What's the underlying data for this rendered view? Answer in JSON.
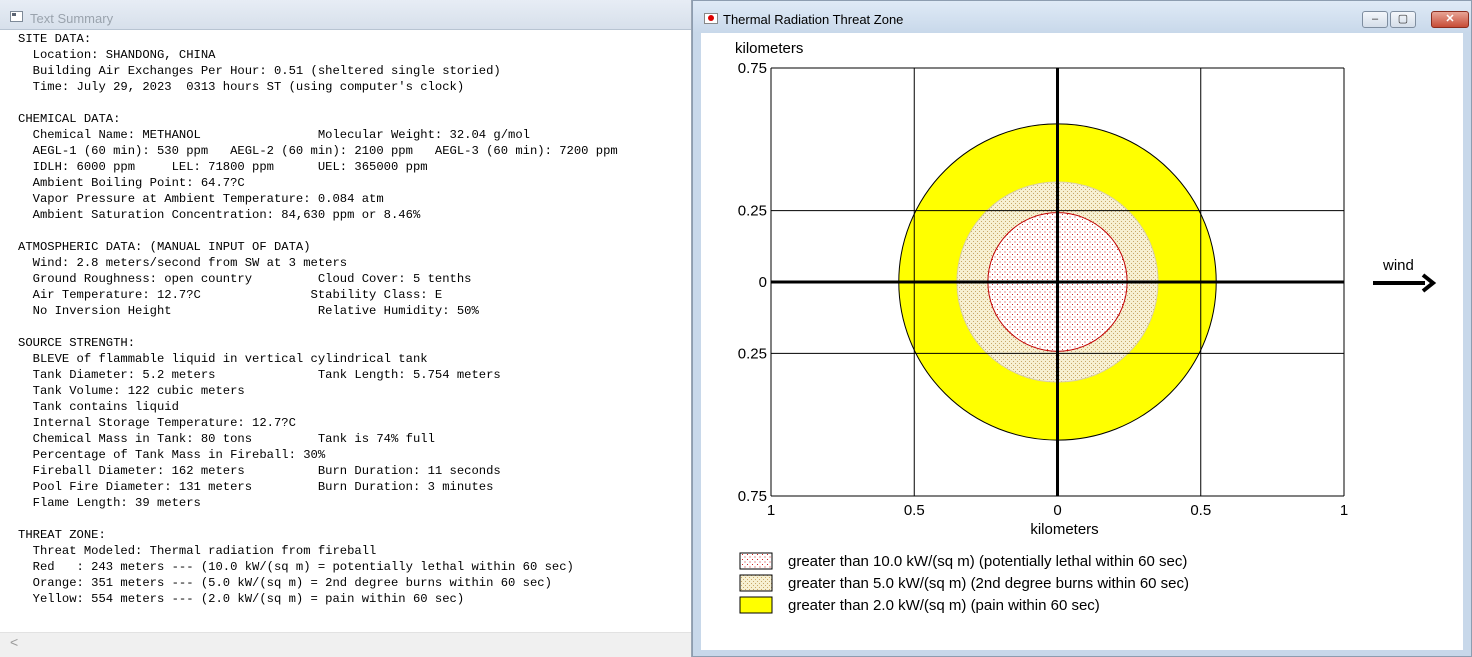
{
  "summary_window": {
    "title": "Text Summary",
    "lines": [
      "SITE DATA:",
      "  Location: SHANDONG, CHINA",
      "  Building Air Exchanges Per Hour: 0.51 (sheltered single storied)",
      "  Time: July 29, 2023  0313 hours ST (using computer's clock)",
      "",
      "CHEMICAL DATA:",
      "  Chemical Name: METHANOL                Molecular Weight: 32.04 g/mol",
      "  AEGL-1 (60 min): 530 ppm   AEGL-2 (60 min): 2100 ppm   AEGL-3 (60 min): 7200 ppm",
      "  IDLH: 6000 ppm     LEL: 71800 ppm      UEL: 365000 ppm",
      "  Ambient Boiling Point: 64.7?C",
      "  Vapor Pressure at Ambient Temperature: 0.084 atm",
      "  Ambient Saturation Concentration: 84,630 ppm or 8.46%",
      "",
      "ATMOSPHERIC DATA: (MANUAL INPUT OF DATA)",
      "  Wind: 2.8 meters/second from SW at 3 meters",
      "  Ground Roughness: open country         Cloud Cover: 5 tenths",
      "  Air Temperature: 12.7?C               Stability Class: E",
      "  No Inversion Height                    Relative Humidity: 50%",
      "",
      "SOURCE STRENGTH:",
      "  BLEVE of flammable liquid in vertical cylindrical tank",
      "  Tank Diameter: 5.2 meters              Tank Length: 5.754 meters",
      "  Tank Volume: 122 cubic meters",
      "  Tank contains liquid",
      "  Internal Storage Temperature: 12.7?C",
      "  Chemical Mass in Tank: 80 tons         Tank is 74% full",
      "  Percentage of Tank Mass in Fireball: 30%",
      "  Fireball Diameter: 162 meters          Burn Duration: 11 seconds",
      "  Pool Fire Diameter: 131 meters         Burn Duration: 3 minutes",
      "  Flame Length: 39 meters",
      "",
      "THREAT ZONE:",
      "  Threat Modeled: Thermal radiation from fireball",
      "  Red   : 243 meters --- (10.0 kW/(sq m) = potentially lethal within 60 sec)",
      "  Orange: 351 meters --- (5.0 kW/(sq m) = 2nd degree burns within 60 sec)",
      "  Yellow: 554 meters --- (2.0 kW/(sq m) = pain within 60 sec)"
    ],
    "scroll_left_glyph": "<"
  },
  "threat_window": {
    "title": "Thermal Radiation Threat Zone",
    "buttons": {
      "minimize": "–",
      "maximize": "▢",
      "close": "✕"
    },
    "wind_label": "wind"
  },
  "chart_data": {
    "type": "threat-zone-circles",
    "y_axis_unit": "kilometers",
    "x_axis_unit": "kilometers",
    "y_tick_labels": [
      "0.75",
      "0.25",
      "0",
      "0.25",
      "0.75"
    ],
    "x_tick_labels": [
      "1",
      "0.5",
      "0",
      "0.5",
      "1"
    ],
    "xlim": [
      -1,
      1
    ],
    "ylim": [
      -0.75,
      0.75
    ],
    "grid_x": [
      -1,
      -0.5,
      0,
      0.5,
      1
    ],
    "grid_y": [
      -0.75,
      -0.25,
      0,
      0.25,
      0.75
    ],
    "wind_direction": "right",
    "zones": [
      {
        "radius_km": 0.554,
        "color": "#ffff00",
        "pattern": "solid",
        "legend": "greater than 2.0 kW/(sq m) (pain within 60 sec)"
      },
      {
        "radius_km": 0.351,
        "color": "#f2ecc8",
        "pattern": "dots-orange",
        "legend": "greater than 5.0 kW/(sq m) (2nd degree burns within 60 sec)"
      },
      {
        "radius_km": 0.243,
        "color": "#ffffff",
        "pattern": "dots-red",
        "legend": "greater than 10.0 kW/(sq m) (potentially lethal within 60 sec)"
      }
    ],
    "legend_order": [
      2,
      1,
      0
    ]
  }
}
